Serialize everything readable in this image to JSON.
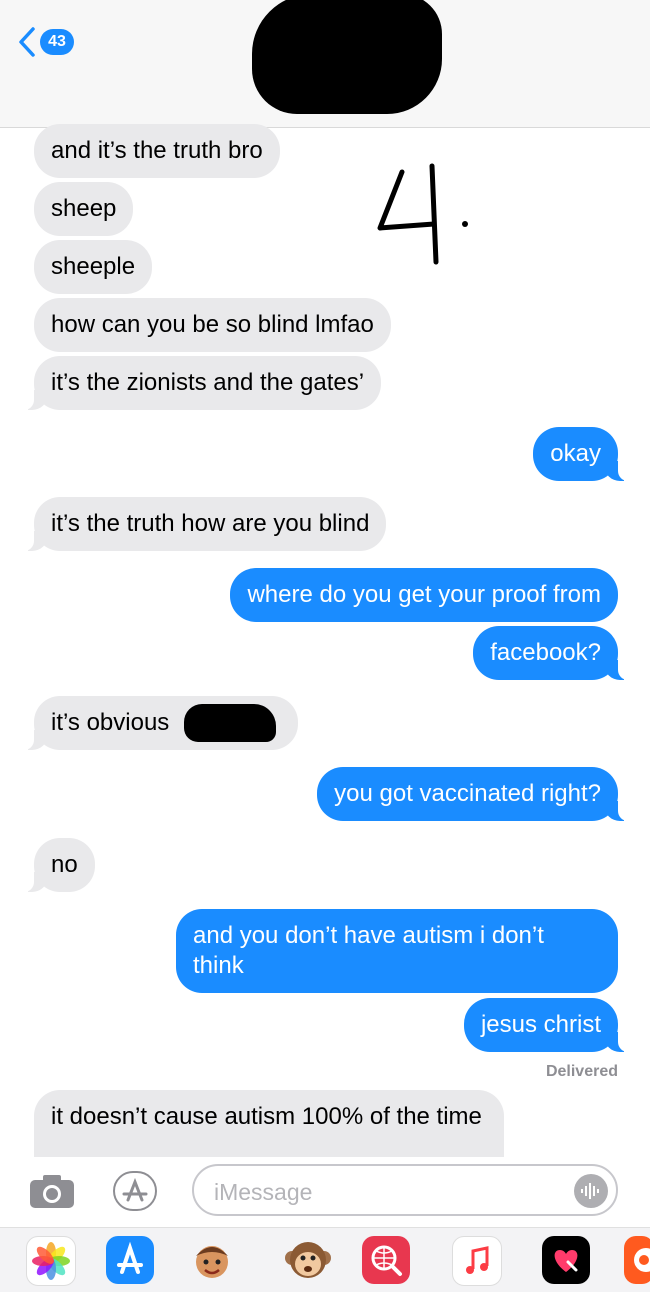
{
  "header": {
    "back_badge": "43"
  },
  "annotation": {
    "mark": "4."
  },
  "messages": [
    {
      "dir": "in",
      "text": "and it’s the truth bro"
    },
    {
      "dir": "in",
      "text": "sheep"
    },
    {
      "dir": "in",
      "text": "sheeple"
    },
    {
      "dir": "in",
      "text": "how can you be so blind lmfao"
    },
    {
      "dir": "in",
      "text": "it’s the zionists and the gates’"
    },
    {
      "dir": "out",
      "text": "okay"
    },
    {
      "dir": "in",
      "text": "it’s the truth how are you blind"
    },
    {
      "dir": "out",
      "text": "where do you get your proof from"
    },
    {
      "dir": "out",
      "text": "facebook?"
    },
    {
      "dir": "in",
      "text": "it’s obvious"
    },
    {
      "dir": "out",
      "text": "you got vaccinated right?"
    },
    {
      "dir": "in",
      "text": "no"
    },
    {
      "dir": "out",
      "text": "and you don’t have autism i don’t think"
    },
    {
      "dir": "out",
      "text": "jesus christ"
    },
    {
      "dir": "in",
      "text": "it doesn’t cause autism 100% of the time"
    }
  ],
  "status": {
    "delivered": "Delivered"
  },
  "compose": {
    "placeholder": "iMessage"
  },
  "app_drawer": [
    {
      "icon": "photos-icon"
    },
    {
      "icon": "app-store-icon"
    },
    {
      "icon": "memoji-icon"
    },
    {
      "icon": "animoji-icon"
    },
    {
      "icon": "web-search-icon"
    },
    {
      "icon": "music-icon"
    },
    {
      "icon": "digital-touch-icon"
    },
    {
      "icon": "app-icon"
    }
  ],
  "colors": {
    "sent_bubble": "#1a8cff",
    "received_bubble": "#e9e9eb",
    "badge": "#1a8cff"
  }
}
